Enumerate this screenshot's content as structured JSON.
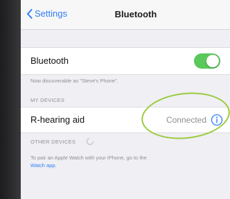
{
  "navbar": {
    "back_label": "Settings",
    "title": "Bluetooth"
  },
  "bluetooth": {
    "label": "Bluetooth",
    "enabled": true,
    "discoverable_note": "Now discoverable as \"Steve's Phone\"."
  },
  "my_devices": {
    "header": "MY DEVICES",
    "items": [
      {
        "name": "R-hearing aid",
        "status": "Connected"
      }
    ]
  },
  "other_devices": {
    "header": "OTHER DEVICES",
    "footer_text": "To pair an Apple Watch with your iPhone, go to the",
    "footer_link": "Watch app."
  },
  "colors": {
    "accent": "#2f7cf6",
    "toggle_on": "#5ac85a",
    "annotation_circle": "#9acb3c"
  },
  "icons": [
    "chevron-left-icon",
    "info-icon",
    "spinner-icon"
  ]
}
